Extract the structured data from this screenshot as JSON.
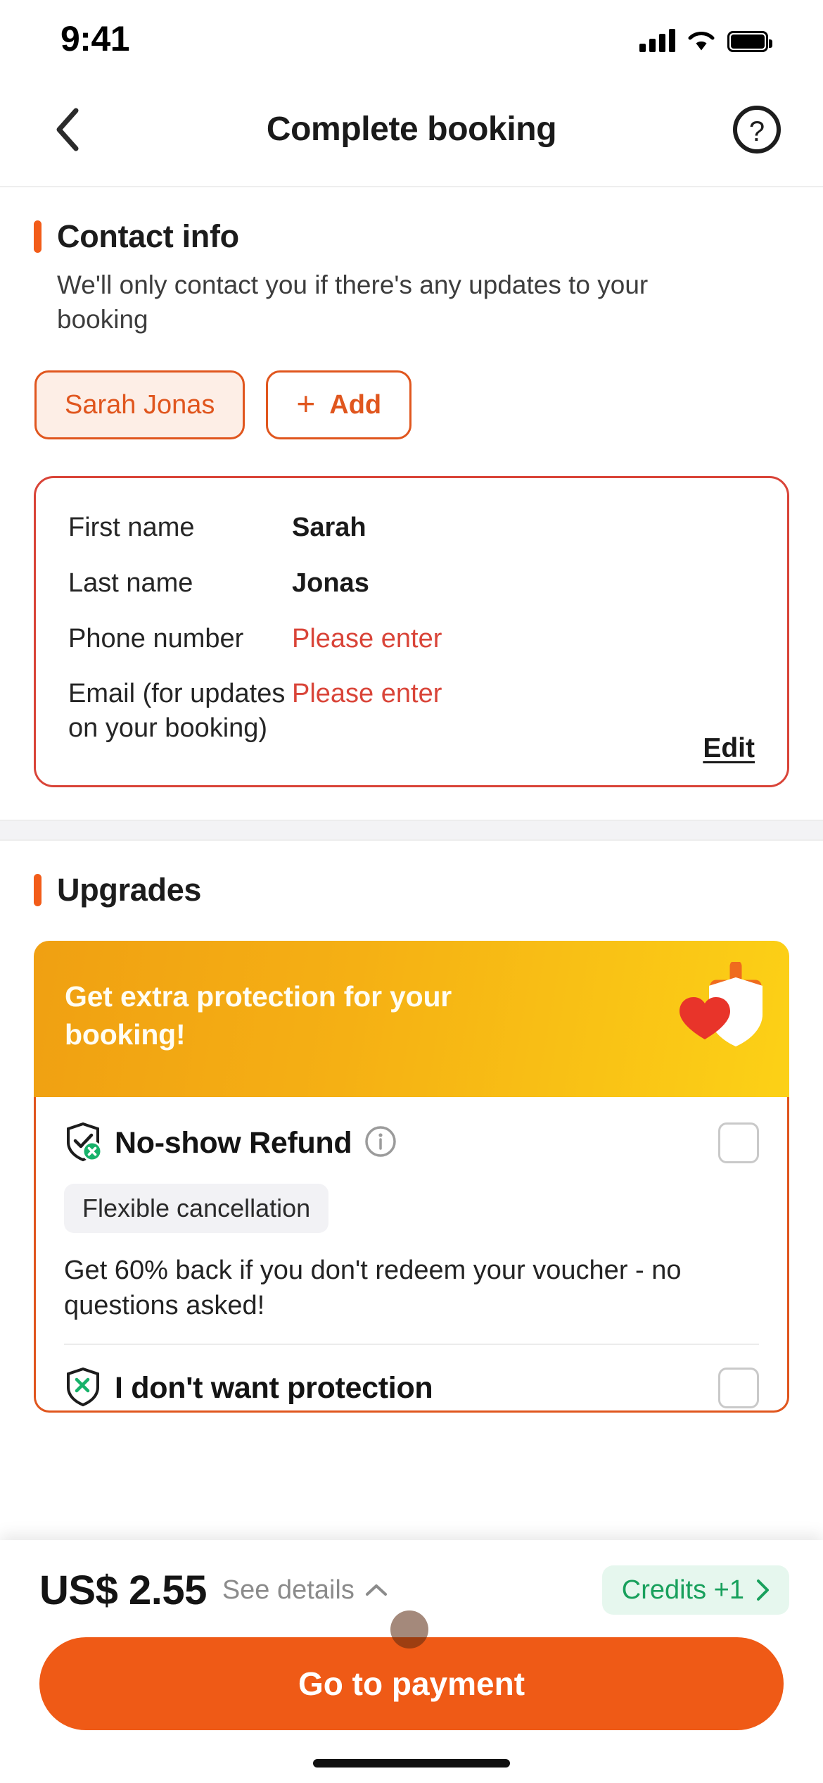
{
  "status_bar": {
    "time": "9:41",
    "signal_icon": "cellular-signal-icon",
    "wifi_icon": "wifi-icon",
    "battery_icon": "battery-full-icon"
  },
  "header": {
    "title": "Complete booking",
    "back_icon": "chevron-left-icon",
    "help_icon": "question-circle-icon"
  },
  "contact": {
    "title": "Contact info",
    "subtitle": "We'll only contact you if there's any updates to your booking",
    "chips": [
      {
        "label": "Sarah Jonas",
        "selected": true
      },
      {
        "label": "Add",
        "icon": "plus-icon",
        "selected": false
      }
    ],
    "fields": [
      {
        "label": "First name",
        "value": "Sarah",
        "error": false
      },
      {
        "label": "Last name",
        "value": "Jonas",
        "error": false
      },
      {
        "label": "Phone number",
        "value": "Please enter",
        "error": true
      },
      {
        "label": "Email (for updates on your booking)",
        "value": "Please enter",
        "error": true
      }
    ],
    "edit_label": "Edit"
  },
  "upgrades": {
    "title": "Upgrades",
    "promo_text": "Get extra protection for your booking!",
    "promo_art_icon": "heart-shield-plus-icon",
    "options": [
      {
        "name": "No-show Refund",
        "icon": "shield-check-icon",
        "info_icon": "info-circle-icon",
        "tag": "Flexible cancellation",
        "description": "Get 60% back if you don't redeem your voucher - no questions asked!",
        "checked": false
      },
      {
        "name": "I don't want protection",
        "icon": "shield-x-icon",
        "checked": false
      }
    ]
  },
  "bottom_bar": {
    "price": "US$ 2.55",
    "details_label": "See details",
    "details_icon": "chevron-up-icon",
    "credits_label": "Credits +1",
    "credits_icon": "chevron-right-icon",
    "cta_label": "Go to payment"
  },
  "colors": {
    "accent_orange": "#f25c19",
    "chip_orange": "#e0561e",
    "error_red": "#d94438",
    "promo_yellow": "#f5b014",
    "credits_green": "#18a05c",
    "cta_orange": "#ef5a16"
  }
}
